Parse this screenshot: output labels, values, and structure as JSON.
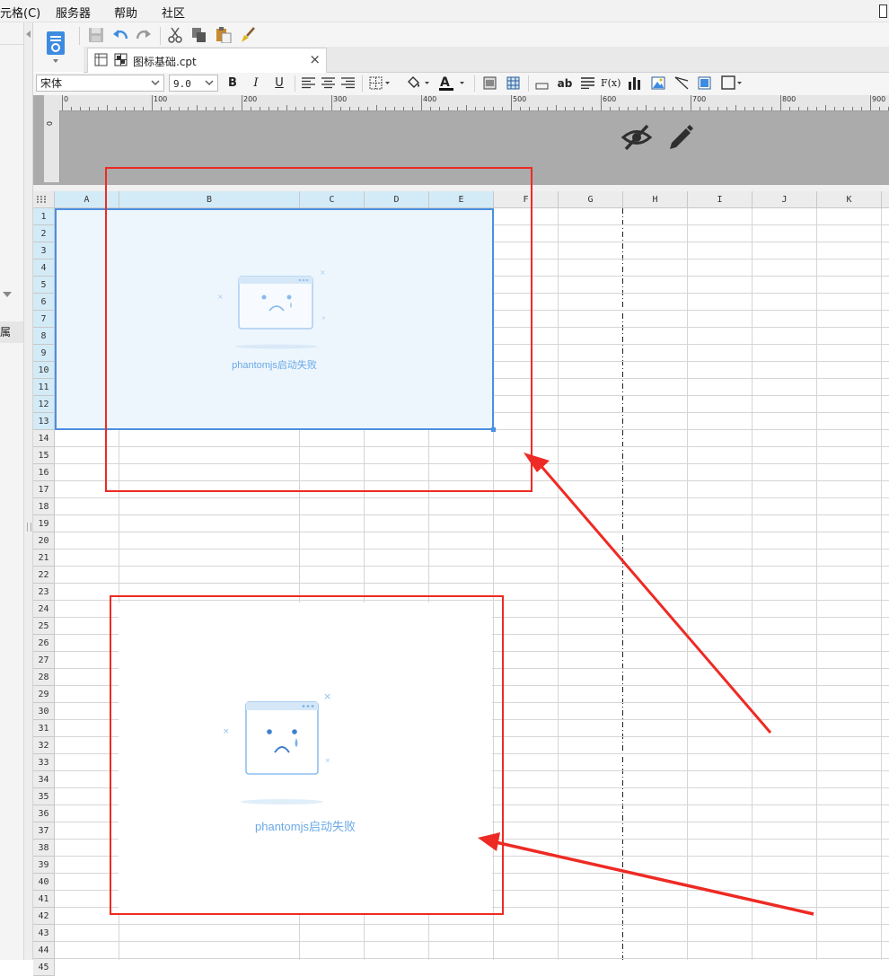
{
  "menu": {
    "items": [
      {
        "id": "cell",
        "label": "元格(C)"
      },
      {
        "id": "server",
        "label": "服务器"
      },
      {
        "id": "help",
        "label": "帮助"
      },
      {
        "id": "community",
        "label": "社区"
      }
    ]
  },
  "left_panel": {
    "label": "属"
  },
  "tabs": {
    "file_tab_label": "图标基础.cpt",
    "close_glyph": "×"
  },
  "format_bar": {
    "font_family": "宋体",
    "font_size": "9.0",
    "bold": "B",
    "italic": "I",
    "underline": "U",
    "text_color_glyph": "A",
    "text_btn": "ab",
    "formula_btn": "F(x)"
  },
  "ruler": {
    "labels": [
      "0",
      "100",
      "200",
      "300",
      "400",
      "500",
      "600",
      "700",
      "800",
      "900"
    ],
    "vertical_label": "0"
  },
  "grid": {
    "columns": [
      {
        "label": "A",
        "width": 72
      },
      {
        "label": "B",
        "width": 201
      },
      {
        "label": "C",
        "width": 72
      },
      {
        "label": "D",
        "width": 72
      },
      {
        "label": "E",
        "width": 72
      },
      {
        "label": "F",
        "width": 72
      },
      {
        "label": "G",
        "width": 72
      },
      {
        "label": "H",
        "width": 72
      },
      {
        "label": "I",
        "width": 72
      },
      {
        "label": "J",
        "width": 72
      },
      {
        "label": "K",
        "width": 72
      },
      {
        "label": "",
        "width": 9
      }
    ],
    "row_count": 45,
    "selected_columns": [
      "A",
      "B",
      "C",
      "D",
      "E"
    ],
    "selected_rows_last": 13,
    "page_break_after_column": "G"
  },
  "charts": {
    "top_error": "phantomjs启动失败",
    "bottom_error": "phantomjs启动失败"
  },
  "colors": {
    "selection_border": "#4a8fe2",
    "selection_fill": "#eef6fd",
    "annotation_red": "#ee2a24",
    "error_text": "#6aa9e6"
  }
}
